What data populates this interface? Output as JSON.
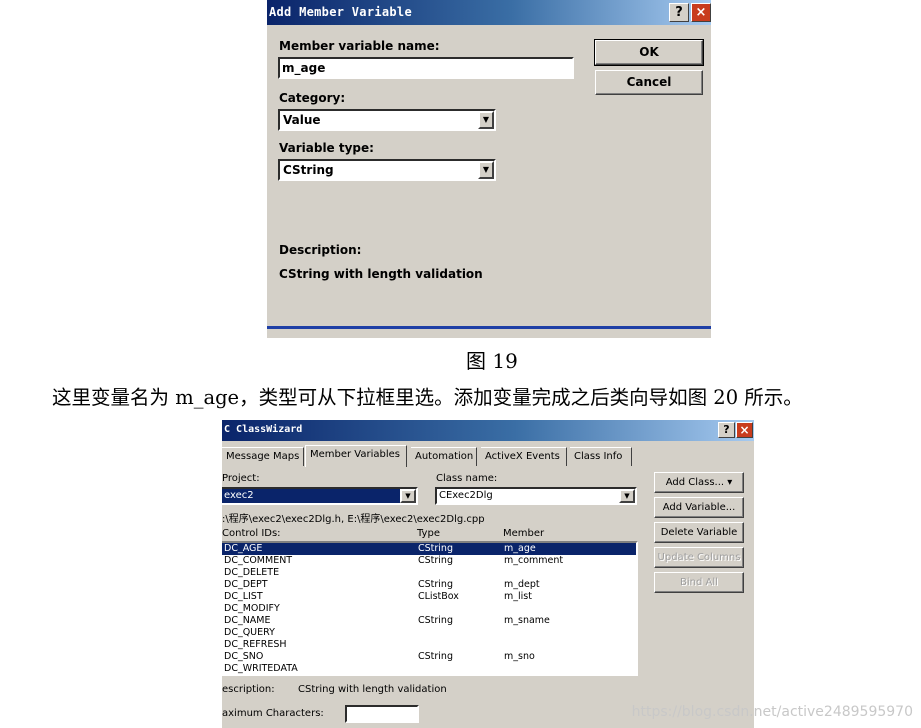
{
  "dialog1": {
    "title": "Add Member Variable",
    "help_btn": "?",
    "close_btn": "×",
    "name_label": "Member variable name:",
    "name_value": "m_age",
    "ok_label": "OK",
    "cancel_label": "Cancel",
    "category_label": "Category:",
    "category_value": "Value",
    "type_label": "Variable type:",
    "type_value": "CString",
    "description_label": "Description:",
    "description_text": "CString with length validation"
  },
  "caption1": "图 19",
  "caption2": "这里变量名为 m_age，类型可从下拉框里选。添加变量完成之后类向导如图 20 所示。",
  "dialog2": {
    "title": "ClassWizard",
    "help_btn": "?",
    "close_btn": "×",
    "tabs": [
      "Message Maps",
      "Member Variables",
      "Automation",
      "ActiveX Events",
      "Class Info"
    ],
    "project_label": "Project:",
    "project_value": "exec2",
    "classname_label": "Class name:",
    "classname_value": "CExec2Dlg",
    "files_text": ":\\程序\\exec2\\exec2Dlg.h, E:\\程序\\exec2\\exec2Dlg.cpp",
    "col_ids": "Control IDs:",
    "col_type": "Type",
    "col_member": "Member",
    "rows": [
      {
        "id": "DC_AGE",
        "type": "CString",
        "member": "m_age"
      },
      {
        "id": "DC_COMMENT",
        "type": "CString",
        "member": "m_comment"
      },
      {
        "id": "DC_DELETE",
        "type": "",
        "member": ""
      },
      {
        "id": "DC_DEPT",
        "type": "CString",
        "member": "m_dept"
      },
      {
        "id": "DC_LIST",
        "type": "CListBox",
        "member": "m_list"
      },
      {
        "id": "DC_MODIFY",
        "type": "",
        "member": ""
      },
      {
        "id": "DC_NAME",
        "type": "CString",
        "member": "m_sname"
      },
      {
        "id": "DC_QUERY",
        "type": "",
        "member": ""
      },
      {
        "id": "DC_REFRESH",
        "type": "",
        "member": ""
      },
      {
        "id": "DC_SNO",
        "type": "CString",
        "member": "m_sno"
      },
      {
        "id": "DC_WRITEDATA",
        "type": "",
        "member": ""
      }
    ],
    "buttons": {
      "add_class": "Add Class... ▾",
      "add_variable": "Add Variable...",
      "delete_variable": "Delete Variable",
      "update_columns": "Update Columns",
      "bind_all": "Bind All"
    },
    "description_label": "escription:",
    "description_text": "CString with length validation",
    "maxchars_label": "aximum Characters:",
    "maxchars_value": ""
  },
  "watermark": "https://blog.csdn.net/active2489595970",
  "colors": {
    "dialog_bg": "#d4d0c8",
    "titlebar_start": "#0a246a",
    "titlebar_end": "#a6caf0",
    "selection": "#0a246a",
    "footer_bar": "#1f3fa6"
  }
}
